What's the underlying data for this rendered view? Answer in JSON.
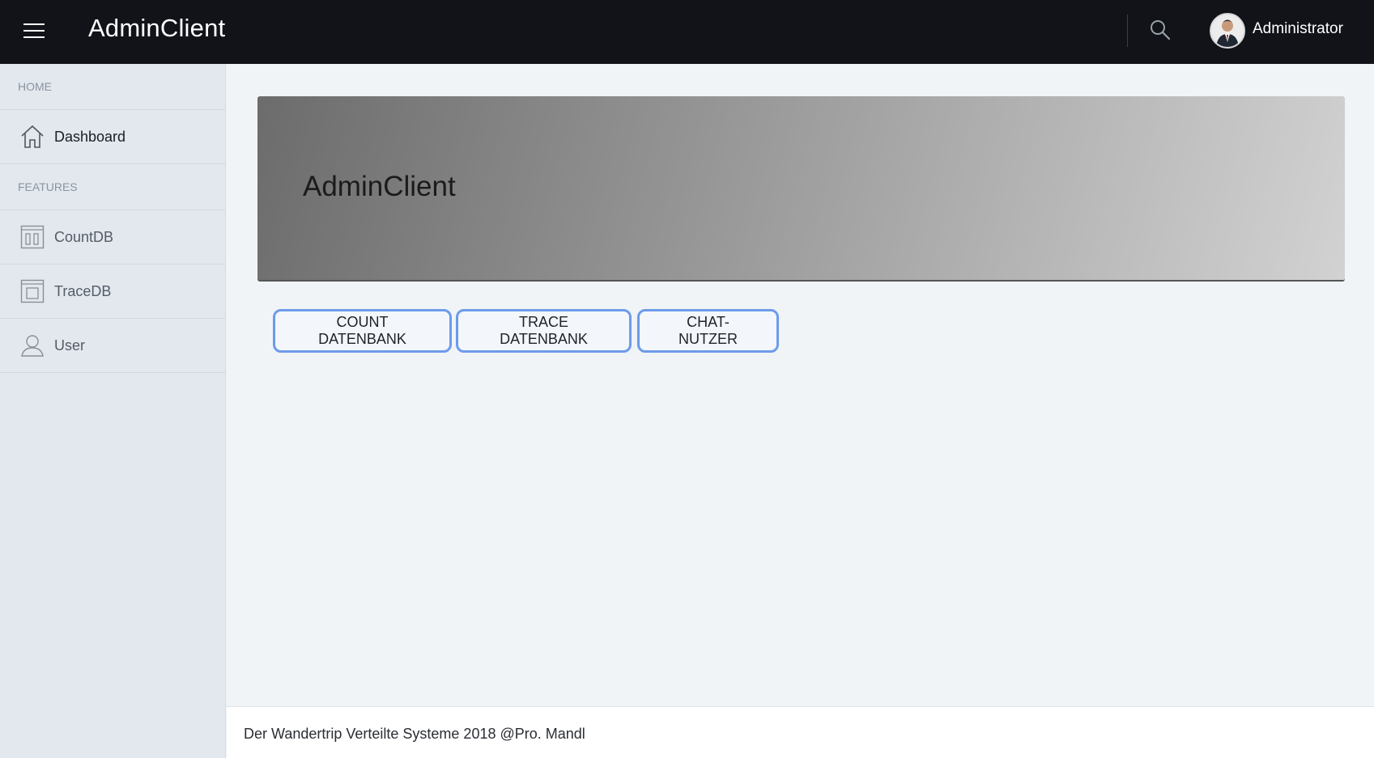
{
  "header": {
    "brand": "AdminClient",
    "user_name": "Administrator",
    "icons": {
      "menu": "hamburger-icon",
      "search": "search-icon",
      "avatar": "avatar"
    },
    "background": "#111319"
  },
  "sidebar": {
    "sections": [
      {
        "label": "HOME"
      },
      {
        "label": "FEATURES"
      }
    ],
    "items": [
      {
        "label": "Dashboard",
        "icon": "home-icon",
        "active": true
      },
      {
        "label": "CountDB",
        "icon": "columns-icon"
      },
      {
        "label": "TraceDB",
        "icon": "window-icon"
      },
      {
        "label": "User",
        "icon": "user-icon"
      }
    ]
  },
  "main": {
    "hero_title": "AdminClient",
    "buttons": [
      {
        "label": "COUNT DATENBANK"
      },
      {
        "label": "TRACE DATENBANK"
      },
      {
        "label": "CHAT-NUTZER"
      }
    ],
    "button_border_color": "#6d9bea"
  },
  "footer": {
    "text": "Der Wandertrip Verteilte Systeme 2018 @Pro. Mandl"
  }
}
